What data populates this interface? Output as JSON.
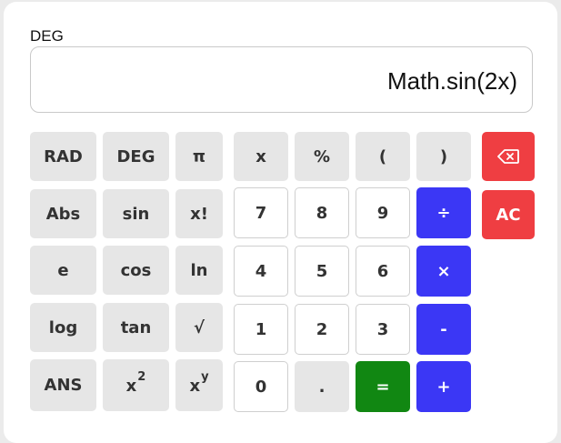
{
  "mode_indicator": "DEG",
  "display": {
    "expression": "Math.sin(2x)"
  },
  "keys": {
    "rad": "RAD",
    "deg": "DEG",
    "pi": "π",
    "x_var": "x",
    "percent": "%",
    "paren_open": "(",
    "paren_close": ")",
    "abs": "Abs",
    "sin": "sin",
    "factorial": "x!",
    "seven": "7",
    "eight": "8",
    "nine": "9",
    "divide": "÷",
    "clear": "AC",
    "e": "e",
    "cos": "cos",
    "ln": "ln",
    "four": "4",
    "five": "5",
    "six": "6",
    "multiply": "×",
    "log": "log",
    "tan": "tan",
    "sqrt": "√",
    "one": "1",
    "two": "2",
    "three": "3",
    "minus": "-",
    "ans": "ANS",
    "square_base": "x",
    "square_exp": "2",
    "power_base": "x",
    "power_exp": "y",
    "zero": "0",
    "decimal": ".",
    "equals": "=",
    "plus": "+"
  },
  "icons": {
    "backspace": "backspace-icon"
  },
  "colors": {
    "operator": "#3b37f5",
    "equals": "#118712",
    "danger": "#ef3e42",
    "function_key": "#e6e6e6"
  }
}
